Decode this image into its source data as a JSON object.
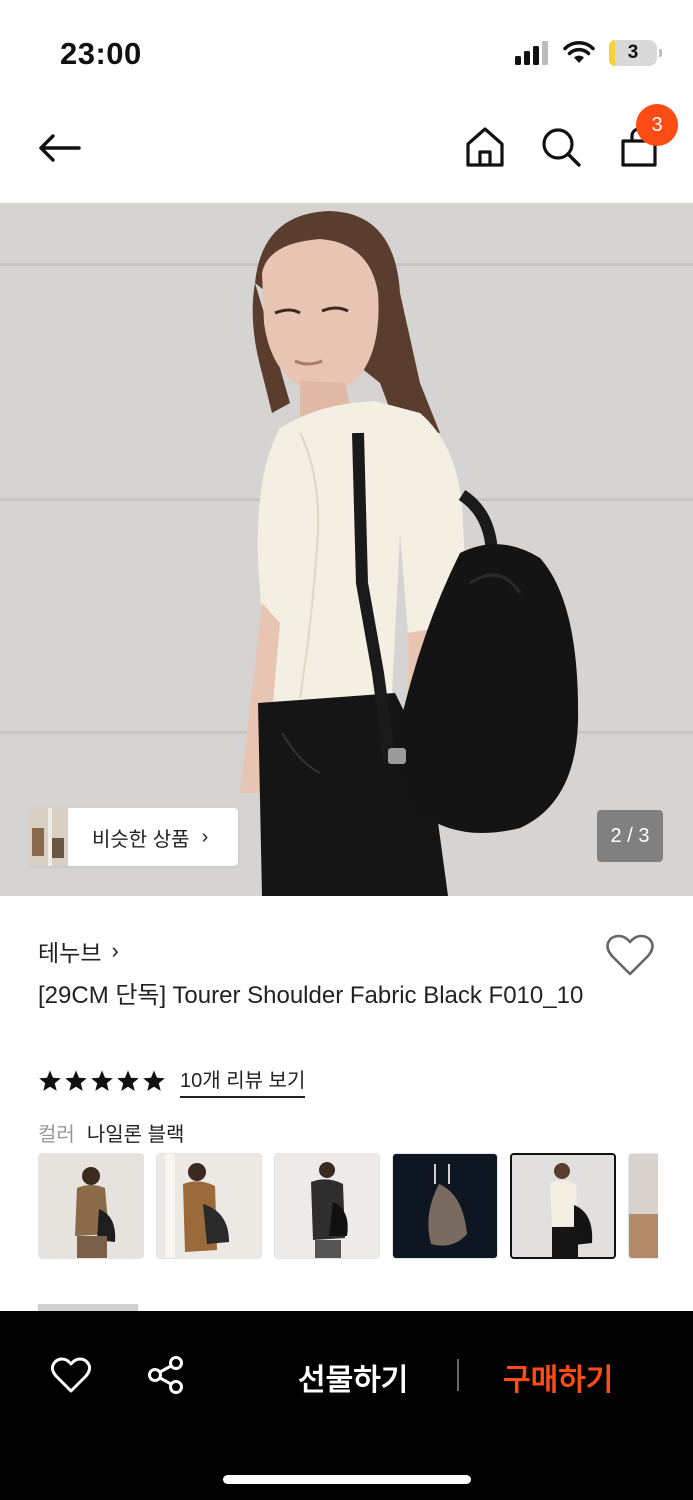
{
  "status_bar": {
    "time": "23:00",
    "battery": "3"
  },
  "nav": {
    "cart_count": "3"
  },
  "hero": {
    "similar_label": "비슷한 상품",
    "page_indicator": "2 / 3"
  },
  "product": {
    "brand": "테누브",
    "title": "[29CM 단독] Tourer Shoulder Fabric Black F010_10",
    "rating": 5,
    "review_link": "10개 리뷰 보기",
    "color_label": "컬러",
    "color_value": "나일론 블랙"
  },
  "bottom_bar": {
    "gift_label": "선물하기",
    "buy_label": "구매하기"
  },
  "colors": {
    "accent": "#ff4b14",
    "bar": "#000000"
  }
}
